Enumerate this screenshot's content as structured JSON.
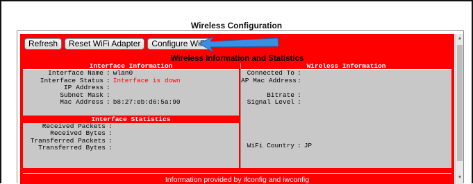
{
  "page_title": "Wireless Configuration",
  "toolbar": {
    "refresh_label": "Refresh",
    "reset_label": "Reset WiFi Adapter",
    "configure_label": "Configure WiFi"
  },
  "section_title": "Wireless Information and Statistics",
  "interface_info": {
    "heading": "Interface Information",
    "rows": [
      {
        "label": "Interface Name",
        "value": "wlan0"
      },
      {
        "label": "Interface Status",
        "value": "Interface is down"
      },
      {
        "label": "IP Address",
        "value": ""
      },
      {
        "label": "Subnet Mask",
        "value": ""
      },
      {
        "label": "Mac Address",
        "value": "b8:27:eb:d6:5a:90"
      }
    ]
  },
  "interface_stats": {
    "heading": "Interface Statistics",
    "rows": [
      {
        "label": "Received Packets",
        "value": ""
      },
      {
        "label": "Received Bytes",
        "value": ""
      },
      {
        "label": "Transferred Packets",
        "value": ""
      },
      {
        "label": "Transferred Bytes",
        "value": ""
      }
    ]
  },
  "wireless_info": {
    "heading": "Wireless Information",
    "rows": [
      {
        "label": "Connected To",
        "value": ""
      },
      {
        "label": "AP Mac Address",
        "value": ""
      },
      {
        "label": "Bitrate",
        "value": ""
      },
      {
        "label": "Signal Level",
        "value": ""
      },
      {
        "label": "WiFi Country",
        "value": "JP"
      }
    ]
  },
  "footer": "Information provided by ifconfig and iwconfig",
  "colors": {
    "panel_red": "#ff0000",
    "data_grey": "#c8c8c8",
    "arrow_blue": "#3a8ee6"
  },
  "icons": {
    "annotation_arrow": "arrow-left-icon",
    "scroll_up": "scroll-up-icon",
    "scroll_down": "scroll-down-icon"
  }
}
